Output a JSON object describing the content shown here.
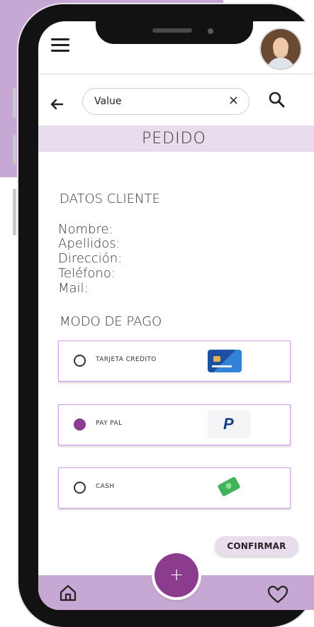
{
  "search": {
    "value": "Value",
    "clear_glyph": "×"
  },
  "page": {
    "title": "PEDIDO"
  },
  "client": {
    "section_title": "DATOS CLIENTE",
    "labels": [
      "Nombre:",
      "Apellidos:",
      "Dirección:",
      "Teléfono:",
      "Mail:"
    ]
  },
  "payment": {
    "section_title": "MODO DE PAGO",
    "options": [
      {
        "label": "TARJETA CREDITO",
        "selected": false,
        "icon": "credit-card-icon"
      },
      {
        "label": "PAY PAL",
        "selected": true,
        "icon": "paypal-icon"
      },
      {
        "label": "CASH",
        "selected": false,
        "icon": "cash-icon"
      }
    ]
  },
  "actions": {
    "confirm_label": "CONFIRMAR",
    "fab_label": "+"
  },
  "bottom_nav": {
    "left_icon": "home-icon",
    "right_icon": "heart-icon"
  },
  "icons": {
    "menu": "menu-icon",
    "back": "arrow-left-icon",
    "search": "search-icon",
    "profile": "avatar"
  },
  "colors": {
    "accent": "#8b3c8d",
    "accent_light": "#c7a7d3",
    "band_light": "#e9dced",
    "option_border": "#d59ee4"
  },
  "paypal_letter": "P"
}
